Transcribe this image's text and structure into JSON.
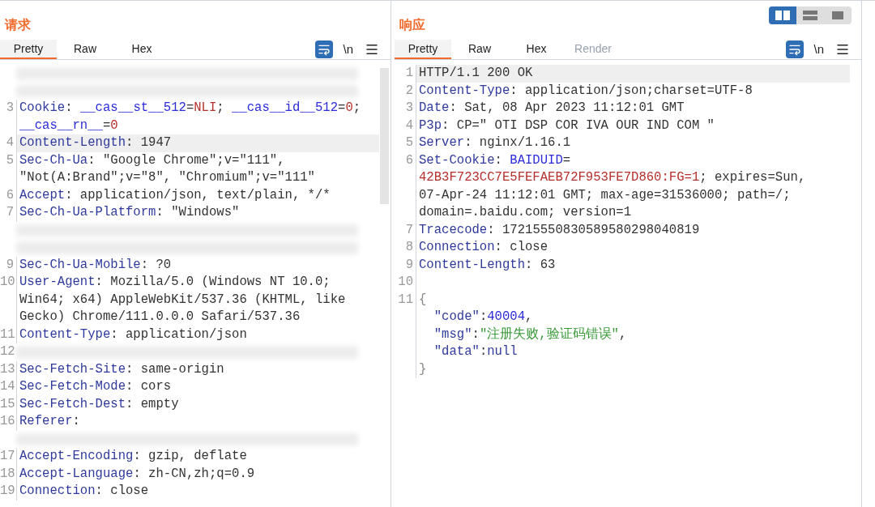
{
  "layout_buttons": [
    {
      "kind": "split",
      "selected": true
    },
    {
      "kind": "stacked",
      "selected": false
    },
    {
      "kind": "single",
      "selected": false
    }
  ],
  "panels": [
    {
      "title": "请求",
      "tabs": [
        {
          "label": "Pretty",
          "selected": true,
          "disabled": false
        },
        {
          "label": "Raw",
          "selected": false,
          "disabled": false
        },
        {
          "label": "Hex",
          "selected": false,
          "disabled": false
        }
      ],
      "tools": {
        "wrap_on": true,
        "newline_label": "\\n"
      },
      "scrollbar": true,
      "rows": [
        {
          "kind": "blurred"
        },
        {
          "kind": "blurred"
        },
        {
          "kind": "line",
          "number": "3",
          "highlighted": false,
          "segments": [
            {
              "kind": "key",
              "text": "Cookie"
            },
            {
              "kind": "plain",
              "text": ": "
            },
            {
              "kind": "blue",
              "text": "__cas__st__512"
            },
            {
              "kind": "plain",
              "text": "="
            },
            {
              "kind": "red",
              "text": "NLI"
            },
            {
              "kind": "plain",
              "text": "; "
            },
            {
              "kind": "blue",
              "text": "__cas__id__512"
            },
            {
              "kind": "plain",
              "text": "="
            },
            {
              "kind": "red",
              "text": "0"
            },
            {
              "kind": "plain",
              "text": ";"
            }
          ]
        },
        {
          "kind": "line",
          "highlighted": false,
          "segments": [
            {
              "kind": "blue",
              "text": "__cas__rn__"
            },
            {
              "kind": "plain",
              "text": "="
            },
            {
              "kind": "red",
              "text": "0"
            }
          ]
        },
        {
          "kind": "line",
          "number": "4",
          "highlighted": true,
          "segments": [
            {
              "kind": "key",
              "text": "Content-Length"
            },
            {
              "kind": "plain",
              "text": ": 1947"
            }
          ]
        },
        {
          "kind": "line",
          "number": "5",
          "highlighted": false,
          "segments": [
            {
              "kind": "key",
              "text": "Sec-Ch-Ua"
            },
            {
              "kind": "plain",
              "text": ": \"Google Chrome\";v=\"111\","
            }
          ]
        },
        {
          "kind": "line",
          "highlighted": false,
          "segments": [
            {
              "kind": "plain",
              "text": "\"Not(A:Brand\";v=\"8\", \"Chromium\";v=\"111\""
            }
          ]
        },
        {
          "kind": "line",
          "number": "6",
          "highlighted": false,
          "segments": [
            {
              "kind": "key",
              "text": "Accept"
            },
            {
              "kind": "plain",
              "text": ": application/json, text/plain, */*"
            }
          ]
        },
        {
          "kind": "line",
          "number": "7",
          "highlighted": false,
          "segments": [
            {
              "kind": "key",
              "text": "Sec-Ch-Ua-Platform"
            },
            {
              "kind": "plain",
              "text": ": \"Windows\""
            }
          ]
        },
        {
          "kind": "blurred"
        },
        {
          "kind": "blurred"
        },
        {
          "kind": "line",
          "number": "9",
          "highlighted": false,
          "segments": [
            {
              "kind": "key",
              "text": "Sec-Ch-Ua-Mobile"
            },
            {
              "kind": "plain",
              "text": ": ?0"
            }
          ]
        },
        {
          "kind": "line",
          "number": "10",
          "highlighted": false,
          "segments": [
            {
              "kind": "key",
              "text": "User-Agent"
            },
            {
              "kind": "plain",
              "text": ": Mozilla/5.0 (Windows NT 10.0;"
            }
          ]
        },
        {
          "kind": "line",
          "highlighted": false,
          "segments": [
            {
              "kind": "plain",
              "text": "Win64; x64) AppleWebKit/537.36 (KHTML, like"
            }
          ]
        },
        {
          "kind": "line",
          "highlighted": false,
          "segments": [
            {
              "kind": "plain",
              "text": "Gecko) Chrome/111.0.0.0 Safari/537.36"
            }
          ]
        },
        {
          "kind": "line",
          "number": "11",
          "highlighted": false,
          "segments": [
            {
              "kind": "key",
              "text": "Content-Type"
            },
            {
              "kind": "plain",
              "text": ": application/json"
            }
          ]
        },
        {
          "kind": "blurred",
          "number": "12"
        },
        {
          "kind": "line",
          "number": "13",
          "highlighted": false,
          "segments": [
            {
              "kind": "key",
              "text": "Sec-Fetch-Site"
            },
            {
              "kind": "plain",
              "text": ": same-origin"
            }
          ]
        },
        {
          "kind": "line",
          "number": "14",
          "highlighted": false,
          "segments": [
            {
              "kind": "key",
              "text": "Sec-Fetch-Mode"
            },
            {
              "kind": "plain",
              "text": ": cors"
            }
          ]
        },
        {
          "kind": "line",
          "number": "15",
          "highlighted": false,
          "segments": [
            {
              "kind": "key",
              "text": "Sec-Fetch-Dest"
            },
            {
              "kind": "plain",
              "text": ": empty"
            }
          ]
        },
        {
          "kind": "line",
          "number": "16",
          "highlighted": false,
          "segments": [
            {
              "kind": "key",
              "text": "Referer"
            },
            {
              "kind": "plain",
              "text": ":"
            }
          ]
        },
        {
          "kind": "blurred"
        },
        {
          "kind": "line",
          "number": "17",
          "highlighted": false,
          "segments": [
            {
              "kind": "key",
              "text": "Accept-Encoding"
            },
            {
              "kind": "plain",
              "text": ": gzip, deflate"
            }
          ]
        },
        {
          "kind": "line",
          "number": "18",
          "highlighted": false,
          "segments": [
            {
              "kind": "key",
              "text": "Accept-Language"
            },
            {
              "kind": "plain",
              "text": ": zh-CN,zh;q=0.9"
            }
          ]
        },
        {
          "kind": "line",
          "number": "19",
          "highlighted": false,
          "segments": [
            {
              "kind": "key",
              "text": "Connection"
            },
            {
              "kind": "plain",
              "text": ": close"
            }
          ]
        }
      ]
    },
    {
      "title": "响应",
      "tabs": [
        {
          "label": "Pretty",
          "selected": true,
          "disabled": false
        },
        {
          "label": "Raw",
          "selected": false,
          "disabled": false
        },
        {
          "label": "Hex",
          "selected": false,
          "disabled": false
        },
        {
          "label": "Render",
          "selected": false,
          "disabled": true
        }
      ],
      "tools": {
        "wrap_on": true,
        "newline_label": "\\n"
      },
      "scrollbar": false,
      "rows": [
        {
          "kind": "line",
          "number": "1",
          "highlighted": true,
          "segments": [
            {
              "kind": "plain",
              "text": "HTTP/1.1 200 OK"
            }
          ]
        },
        {
          "kind": "line",
          "number": "2",
          "highlighted": false,
          "segments": [
            {
              "kind": "key",
              "text": "Content-Type"
            },
            {
              "kind": "plain",
              "text": ": application/json;charset=UTF-8"
            }
          ]
        },
        {
          "kind": "line",
          "number": "3",
          "highlighted": false,
          "segments": [
            {
              "kind": "key",
              "text": "Date"
            },
            {
              "kind": "plain",
              "text": ": Sat, 08 Apr 2023 11:12:01 GMT"
            }
          ]
        },
        {
          "kind": "line",
          "number": "4",
          "highlighted": false,
          "segments": [
            {
              "kind": "key",
              "text": "P3p"
            },
            {
              "kind": "plain",
              "text": ": CP=\" OTI DSP COR IVA OUR IND COM \""
            }
          ]
        },
        {
          "kind": "line",
          "number": "5",
          "highlighted": false,
          "segments": [
            {
              "kind": "key",
              "text": "Server"
            },
            {
              "kind": "plain",
              "text": ": nginx/1.16.1"
            }
          ]
        },
        {
          "kind": "line",
          "number": "6",
          "highlighted": false,
          "segments": [
            {
              "kind": "key",
              "text": "Set-Cookie"
            },
            {
              "kind": "plain",
              "text": ": "
            },
            {
              "kind": "blue",
              "text": "BAIDUID"
            },
            {
              "kind": "plain",
              "text": "="
            }
          ]
        },
        {
          "kind": "line",
          "highlighted": false,
          "segments": [
            {
              "kind": "red",
              "text": "42B3F723CC7E5FEFAEB72F953FE7D860:FG=1"
            },
            {
              "kind": "plain",
              "text": "; expires=Sun,"
            }
          ]
        },
        {
          "kind": "line",
          "highlighted": false,
          "segments": [
            {
              "kind": "plain",
              "text": "07-Apr-24 11:12:01 GMT; max-age=31536000; path=/;"
            }
          ]
        },
        {
          "kind": "line",
          "highlighted": false,
          "segments": [
            {
              "kind": "plain",
              "text": "domain=.baidu.com; version=1"
            }
          ]
        },
        {
          "kind": "line",
          "number": "7",
          "highlighted": false,
          "segments": [
            {
              "kind": "key",
              "text": "Tracecode"
            },
            {
              "kind": "plain",
              "text": ": 17215550830589580298040819"
            }
          ]
        },
        {
          "kind": "line",
          "number": "8",
          "highlighted": false,
          "segments": [
            {
              "kind": "key",
              "text": "Connection"
            },
            {
              "kind": "plain",
              "text": ": close"
            }
          ]
        },
        {
          "kind": "line",
          "number": "9",
          "highlighted": false,
          "segments": [
            {
              "kind": "key",
              "text": "Content-Length"
            },
            {
              "kind": "plain",
              "text": ": 63"
            }
          ]
        },
        {
          "kind": "line",
          "number": "10",
          "highlighted": false
        },
        {
          "kind": "line",
          "number": "11",
          "highlighted": false,
          "segments": [
            {
              "kind": "gray",
              "text": "{"
            }
          ]
        },
        {
          "kind": "line",
          "highlighted": false,
          "segments": [
            {
              "kind": "key",
              "text": "  \"code\""
            },
            {
              "kind": "plain",
              "text": ":"
            },
            {
              "kind": "blue",
              "text": "40004"
            },
            {
              "kind": "plain",
              "text": ","
            }
          ]
        },
        {
          "kind": "line",
          "highlighted": false,
          "segments": [
            {
              "kind": "key",
              "text": "  \"msg\""
            },
            {
              "kind": "plain",
              "text": ":"
            },
            {
              "kind": "green",
              "text": "\"注册失败,验证码错误\""
            },
            {
              "kind": "plain",
              "text": ","
            }
          ]
        },
        {
          "kind": "line",
          "highlighted": false,
          "segments": [
            {
              "kind": "key",
              "text": "  \"data\""
            },
            {
              "kind": "plain",
              "text": ":"
            },
            {
              "kind": "key",
              "text": "null"
            }
          ]
        },
        {
          "kind": "line",
          "highlighted": false,
          "segments": [
            {
              "kind": "gray",
              "text": "}"
            }
          ]
        }
      ]
    }
  ]
}
